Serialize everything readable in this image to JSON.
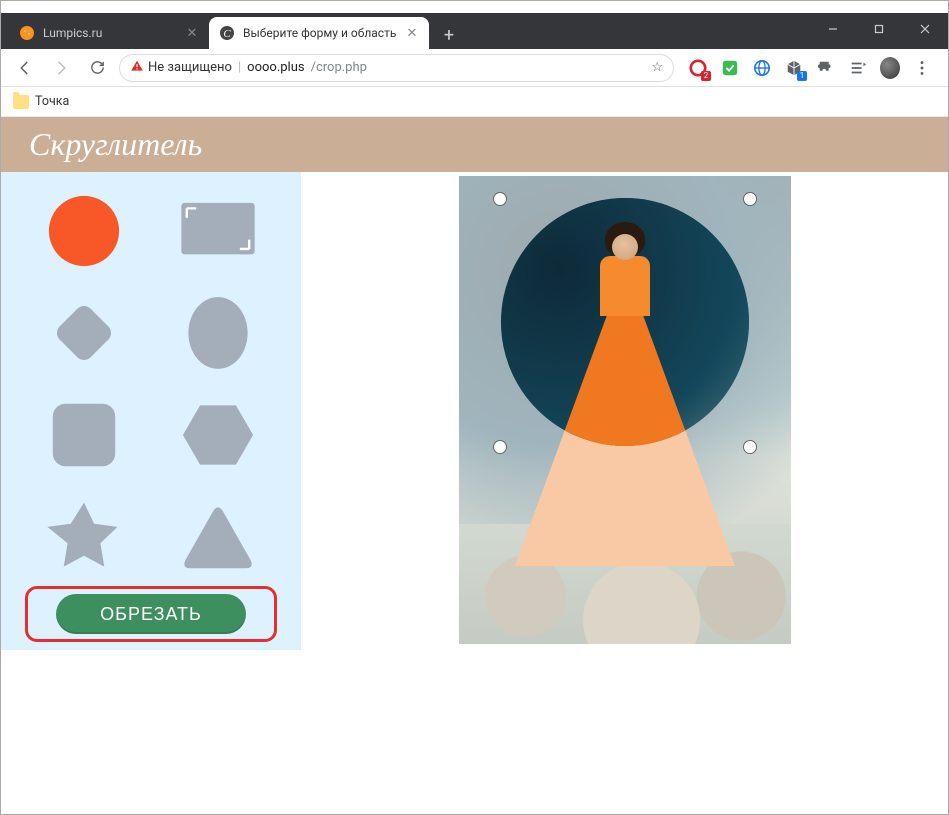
{
  "window": {
    "minimize": "—",
    "maximize": "□",
    "close": "✕"
  },
  "tabs": [
    {
      "title": "Lumpics.ru",
      "active": false
    },
    {
      "title": "Выберите форму и область для",
      "active": true
    }
  ],
  "newTab": "+",
  "nav": {
    "back": "←",
    "forward": "→",
    "reload": "⟳"
  },
  "omnibox": {
    "securityLabel": "Не защищено",
    "separator": "|",
    "host": "oooo.plus",
    "path": "/crop.php",
    "star": "☆"
  },
  "toolbarBadges": {
    "opera": "2",
    "cube": "1"
  },
  "bookmarks": [
    {
      "label": "Точка"
    }
  ],
  "page": {
    "brand": "Скруглитель",
    "shapes": [
      {
        "id": "circle",
        "selected": true
      },
      {
        "id": "rectangle-crop",
        "selected": false
      },
      {
        "id": "diamond",
        "selected": false
      },
      {
        "id": "ellipse",
        "selected": false
      },
      {
        "id": "rounded-square",
        "selected": false
      },
      {
        "id": "hexagon",
        "selected": false
      },
      {
        "id": "star",
        "selected": false
      },
      {
        "id": "triangle",
        "selected": false
      }
    ],
    "cropButton": "ОБРЕЗАТЬ",
    "colors": {
      "shapeInactive": "#a4adba",
      "shapeActive": "#f85827",
      "panelBg": "#def1ff",
      "headerBg": "#cbae96",
      "button": "#3e8f5f",
      "highlight": "#e63030"
    }
  }
}
